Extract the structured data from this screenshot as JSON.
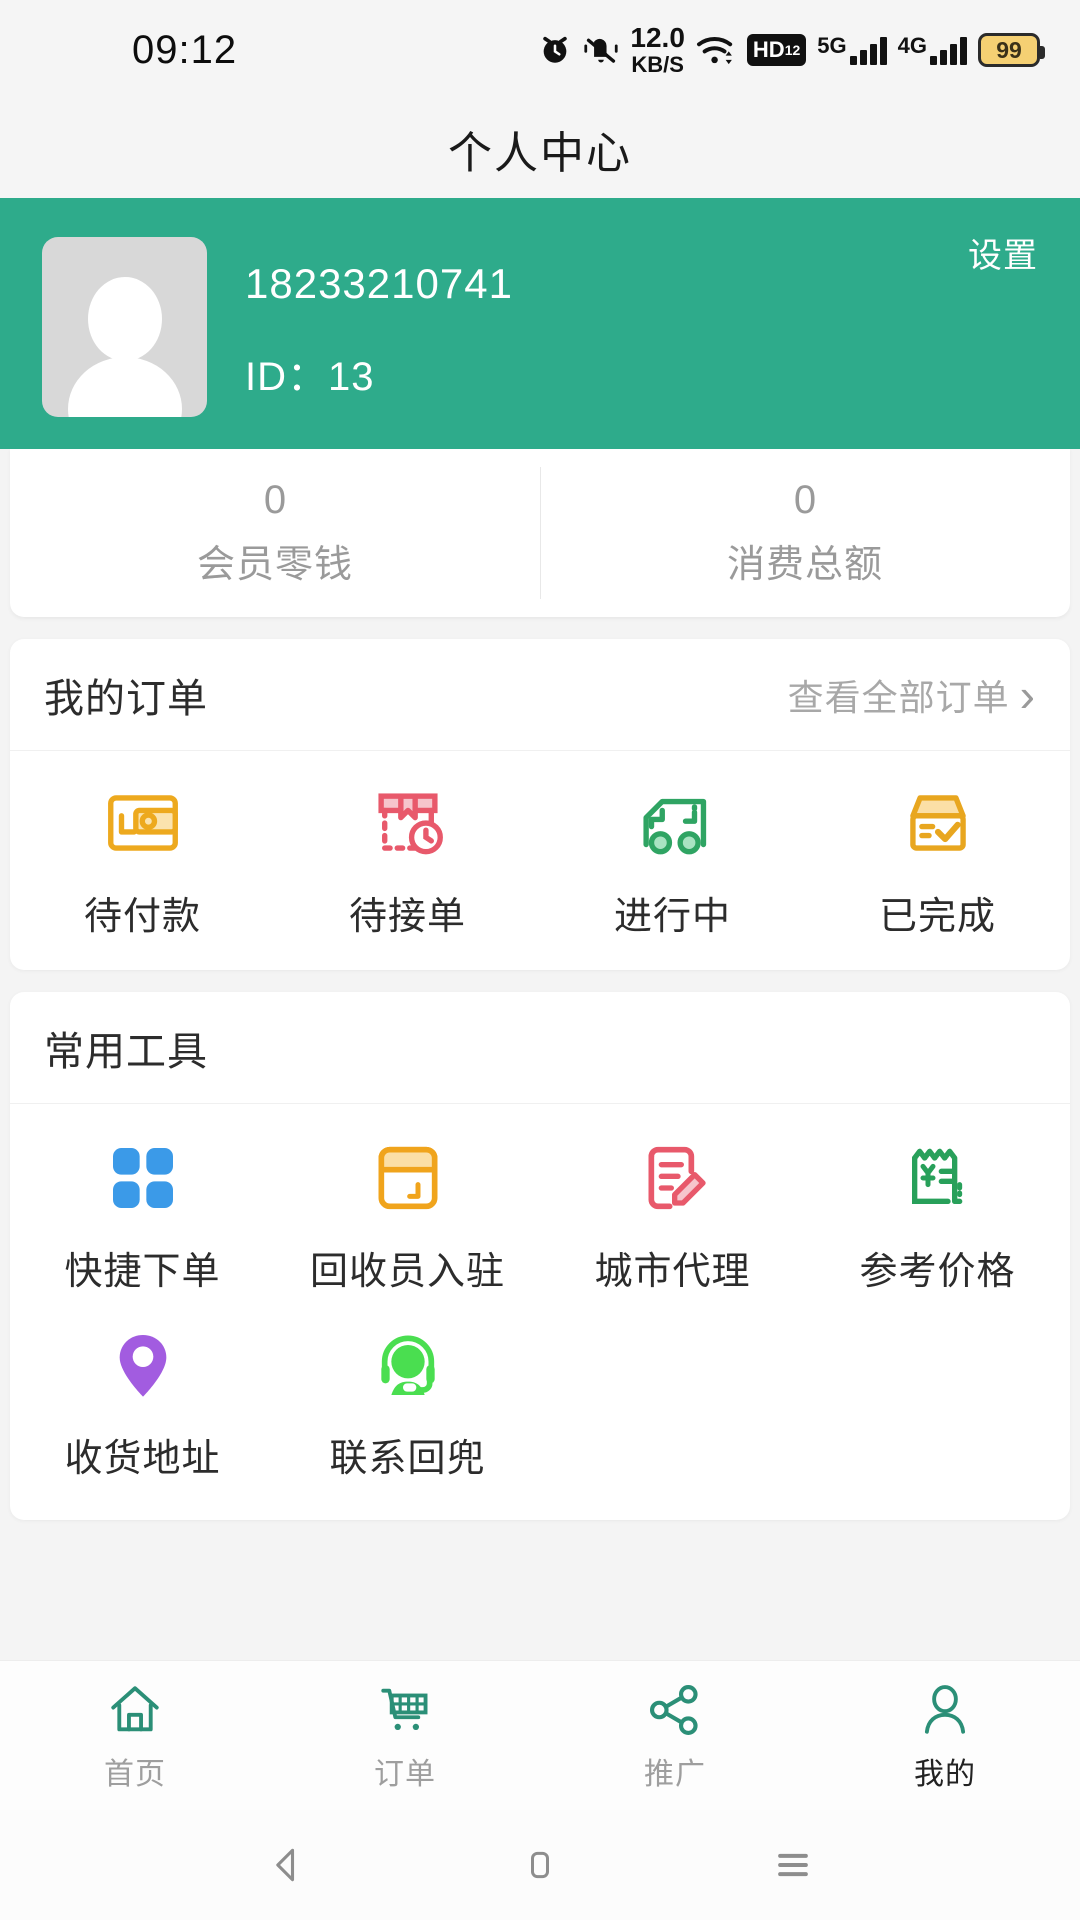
{
  "statusbar": {
    "time": "09:12",
    "netspeed_value": "12.0",
    "netspeed_unit": "KB/S",
    "hd_label": "HD",
    "hd_sup": "1",
    "hd_sub": "2",
    "sim1_label": "5G",
    "sim2_label": "4G",
    "battery_percent": "99",
    "icons": [
      "alarm-icon",
      "mute-bell-icon",
      "wifi-icon",
      "hd-voice-icon",
      "signal-5g-icon",
      "signal-4g-icon",
      "battery-icon"
    ]
  },
  "header": {
    "title": "个人中心"
  },
  "profile": {
    "settings_label": "设置",
    "phone": "18233210741",
    "id_label": "ID：",
    "id_value": "13",
    "bg_color": "#2eab8b",
    "avatar_icon": "user-avatar-icon"
  },
  "stats": [
    {
      "value": "0",
      "label": "会员零钱"
    },
    {
      "value": "0",
      "label": "消费总额"
    }
  ],
  "orders": {
    "title": "我的订单",
    "more_label": "查看全部订单",
    "chevron": "›",
    "items": [
      {
        "label": "待付款",
        "icon": "wallet-icon",
        "color": "#eda91e"
      },
      {
        "label": "待接单",
        "icon": "box-clock-icon",
        "color": "#e8596b"
      },
      {
        "label": "进行中",
        "icon": "truck-icon",
        "color": "#2fa463"
      },
      {
        "label": "已完成",
        "icon": "box-check-icon",
        "color": "#e8a61f"
      }
    ]
  },
  "tools": {
    "title": "常用工具",
    "items": [
      {
        "label": "快捷下单",
        "icon": "grid-squares-icon",
        "color": "#3b9ae8"
      },
      {
        "label": "回收员入驻",
        "icon": "card-window-icon",
        "color": "#f0a41c"
      },
      {
        "label": "城市代理",
        "icon": "document-edit-icon",
        "color": "#e8596b"
      },
      {
        "label": "参考价格",
        "icon": "receipt-yuan-icon",
        "color": "#28a05a"
      },
      {
        "label": "收货地址",
        "icon": "location-pin-icon",
        "color": "#a25ce0"
      },
      {
        "label": "联系回兜",
        "icon": "headset-support-icon",
        "color": "#4ade50"
      }
    ]
  },
  "tabbar": {
    "active_color": "#2b8f77",
    "items": [
      {
        "label": "首页",
        "icon": "home-icon",
        "active": false
      },
      {
        "label": "订单",
        "icon": "cart-icon",
        "active": false
      },
      {
        "label": "推广",
        "icon": "share-icon",
        "active": false
      },
      {
        "label": "我的",
        "icon": "person-icon",
        "active": true
      }
    ]
  },
  "navbar": {
    "items": [
      "back-icon",
      "home-square-icon",
      "recents-icon"
    ]
  }
}
